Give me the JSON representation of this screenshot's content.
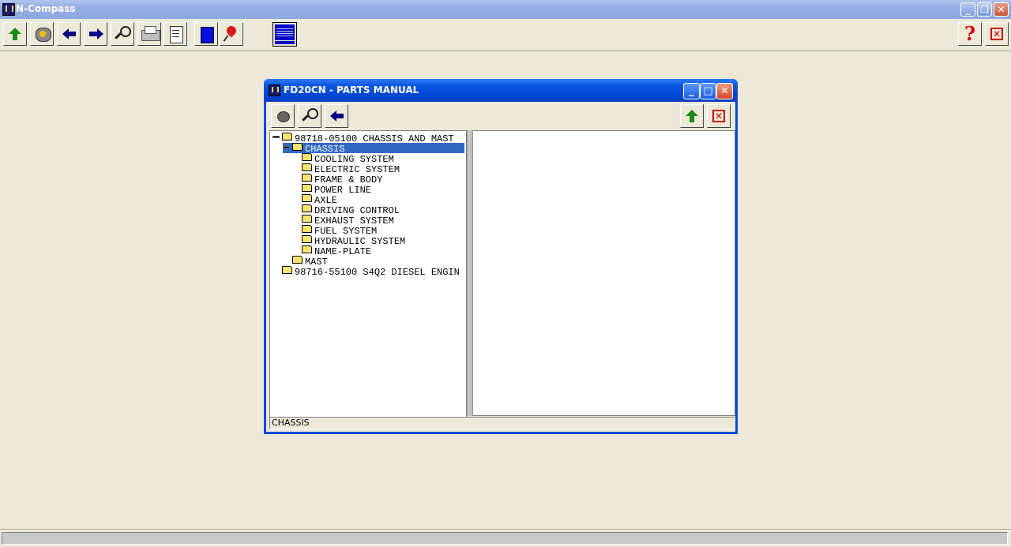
{
  "app": {
    "title": "N-Compass"
  },
  "main_toolbar": {
    "buttons": [
      "up-arrow",
      "open-folder",
      "back",
      "forward",
      "search",
      "print",
      "report",
      "bookmark",
      "pin",
      "display"
    ],
    "right_buttons": [
      "help",
      "close"
    ],
    "help_glyph": "?",
    "close_glyph": "✕"
  },
  "child_window": {
    "title": "FD20CN - PARTS MANUAL",
    "status": "CHASSIS",
    "tree": [
      {
        "label": "98718-05100 CHASSIS AND MAST",
        "level": 0,
        "expanded": true,
        "selected": false
      },
      {
        "label": "CHASSIS",
        "level": 1,
        "expanded": true,
        "selected": true
      },
      {
        "label": "COOLING SYSTEM",
        "level": 2,
        "expanded": false,
        "selected": false
      },
      {
        "label": "ELECTRIC SYSTEM",
        "level": 2,
        "expanded": false,
        "selected": false
      },
      {
        "label": "FRAME & BODY",
        "level": 2,
        "expanded": false,
        "selected": false
      },
      {
        "label": "POWER LINE",
        "level": 2,
        "expanded": false,
        "selected": false
      },
      {
        "label": "AXLE",
        "level": 2,
        "expanded": false,
        "selected": false
      },
      {
        "label": "DRIVING CONTROL",
        "level": 2,
        "expanded": false,
        "selected": false
      },
      {
        "label": "EXHAUST SYSTEM",
        "level": 2,
        "expanded": false,
        "selected": false
      },
      {
        "label": "FUEL SYSTEM",
        "level": 2,
        "expanded": false,
        "selected": false
      },
      {
        "label": "HYDRAULIC SYSTEM",
        "level": 2,
        "expanded": false,
        "selected": false
      },
      {
        "label": "NAME-PLATE",
        "level": 2,
        "expanded": false,
        "selected": false
      },
      {
        "label": "MAST",
        "level": 1,
        "expanded": false,
        "selected": false
      },
      {
        "label": "98716-55100 S4Q2 DIESEL ENGIN",
        "level": 0,
        "expanded": false,
        "selected": false
      }
    ]
  },
  "colors": {
    "desktop": "#ece9d8",
    "selection": "#316ac5",
    "child_title": "#0046d5",
    "folder": "#ffe36a"
  }
}
